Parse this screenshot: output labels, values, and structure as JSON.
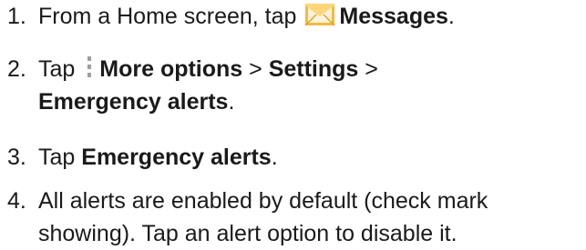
{
  "steps": [
    {
      "number": "1.",
      "text_before": "From a Home screen, tap ",
      "icon": "messages-envelope-icon",
      "bold": "Messages",
      "text_after": "."
    },
    {
      "number": "2.",
      "text_before": "Tap ",
      "icon": "more-options-vertical-dots-icon",
      "bold_1": "More options",
      "sep_1": " > ",
      "bold_2": "Settings",
      "sep_2": " >",
      "bold_3": "Emergency alerts",
      "text_after": "."
    },
    {
      "number": "3.",
      "text_before": "Tap ",
      "bold": "Emergency alerts",
      "text_after": "."
    },
    {
      "number": "4.",
      "line_1": "All alerts are enabled by default (check mark",
      "line_2": "showing). Tap an alert option to disable it."
    }
  ],
  "colors": {
    "envelope_body": "#f6b93b",
    "envelope_flap": "#fbd67a",
    "envelope_paper": "#fdf3dc",
    "dots": "#9e9e9e",
    "text": "#1a1a1a"
  }
}
